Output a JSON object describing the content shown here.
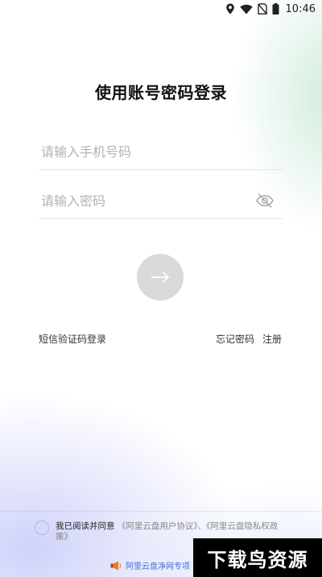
{
  "status_bar": {
    "time": "10:46",
    "icons": [
      "location-icon",
      "wifi-icon",
      "no-sim-icon",
      "battery-icon"
    ]
  },
  "login": {
    "title": "使用账号密码登录",
    "phone_placeholder": "请输入手机号码",
    "password_placeholder": "请输入密码",
    "submit_icon": "arrow-right-icon",
    "sms_login": "短信验证码登录",
    "forgot_password": "忘记密码",
    "register": "注册"
  },
  "agreement": {
    "prefix": "我已阅读并同意",
    "user_agreement": "《阿里云盘用户协议》",
    "separator": "、",
    "privacy_policy": "《阿里云盘隐私权政策》"
  },
  "promo": {
    "text": "阿里云盘净网专项"
  },
  "watermark": {
    "text": "下载鸟资源"
  },
  "colors": {
    "link_blue": "#4a6fd8",
    "button_gray": "#d9d9d9",
    "placeholder_gray": "#b3b3b3"
  }
}
